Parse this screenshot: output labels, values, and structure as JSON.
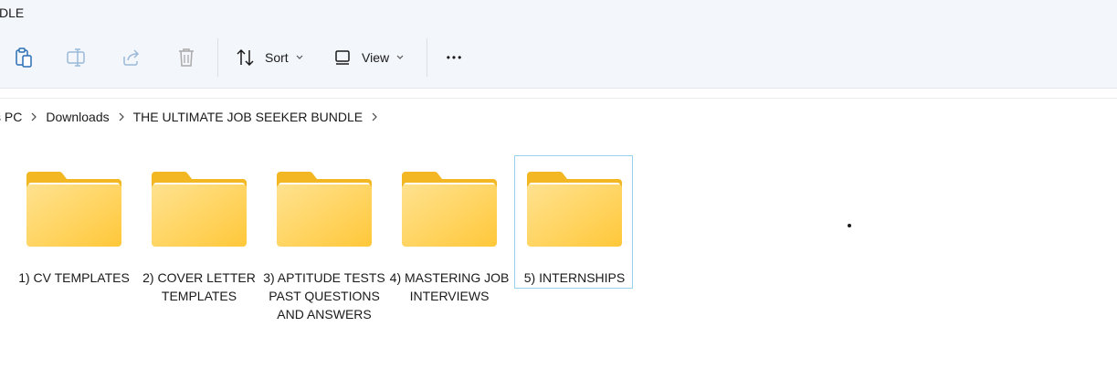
{
  "window": {
    "title": "DLE"
  },
  "toolbar": {
    "buttons": [
      {
        "icon": "clipboard-icon",
        "name": "paste-button"
      },
      {
        "icon": "rename-icon",
        "name": "rename-button"
      },
      {
        "icon": "share-icon",
        "name": "share-button"
      },
      {
        "icon": "trash-icon",
        "name": "delete-button"
      }
    ],
    "sort_label": "Sort",
    "view_label": "View",
    "more_label": "•••"
  },
  "breadcrumb": {
    "items": [
      "s PC",
      "Downloads",
      "THE ULTIMATE JOB SEEKER BUNDLE"
    ]
  },
  "folders": [
    {
      "label": "1) CV TEMPLATES",
      "selected": false
    },
    {
      "label": "2) COVER LETTER TEMPLATES",
      "selected": false
    },
    {
      "label": "3) APTITUDE TESTS PAST QUESTIONS AND ANSWERS",
      "selected": false
    },
    {
      "label": "4) MASTERING JOB INTERVIEWS",
      "selected": false
    },
    {
      "label": "5) INTERNSHIPS",
      "selected": true
    }
  ],
  "colors": {
    "folder_back": "#f2b722",
    "folder_front": "#ffd45c",
    "selection_border": "#99d1f0",
    "toolbar_bg": "#f3f6fb"
  }
}
